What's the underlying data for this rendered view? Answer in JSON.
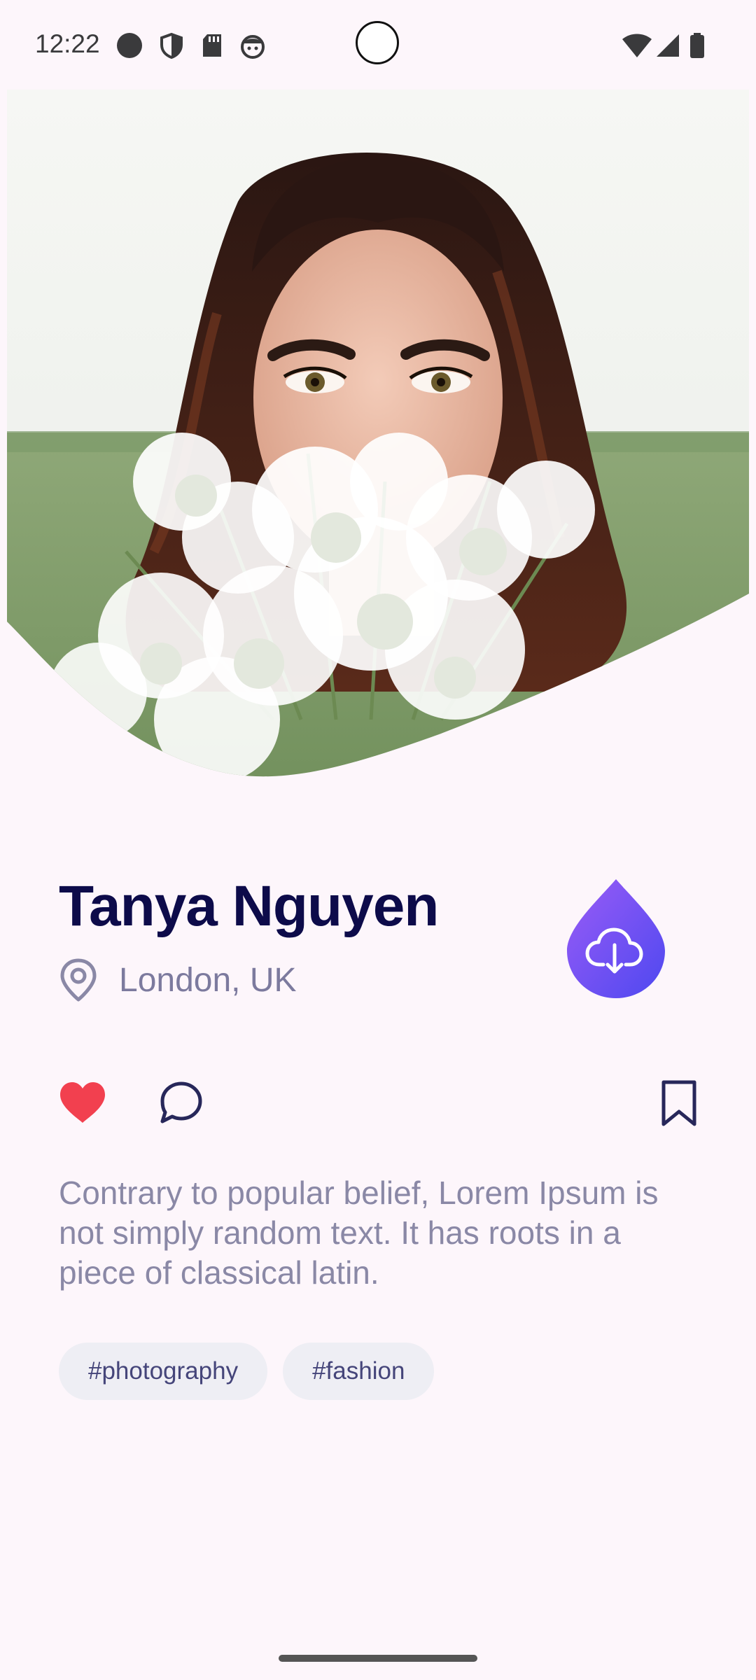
{
  "status_bar": {
    "time": "12:22",
    "left_icons": [
      "circle-icon",
      "shield-icon",
      "sd-card-icon",
      "android-face-icon"
    ],
    "right_icons": [
      "wifi-icon",
      "signal-icon",
      "battery-icon"
    ]
  },
  "hero": {
    "image_icon": "portrait-photo"
  },
  "profile": {
    "name": "Tanya Nguyen",
    "location": "London, UK",
    "location_icon": "location-pin-icon",
    "download_icon": "cloud-download-icon"
  },
  "actions": {
    "like_icon": "heart-icon",
    "comment_icon": "comment-icon",
    "bookmark_icon": "bookmark-icon"
  },
  "description": "Contrary to popular belief, Lorem Ipsum is not simply random text. It has roots in a piece of classical latin.",
  "tags": [
    "#photography",
    "#fashion"
  ],
  "colors": {
    "background": "#fdf6fb",
    "name": "#0d0b4a",
    "muted_text": "#7c7a9e",
    "like": "#f2404f",
    "accent_start": "#8a55f5",
    "accent_end": "#5a4af2",
    "tag_bg": "#eeeef4"
  }
}
